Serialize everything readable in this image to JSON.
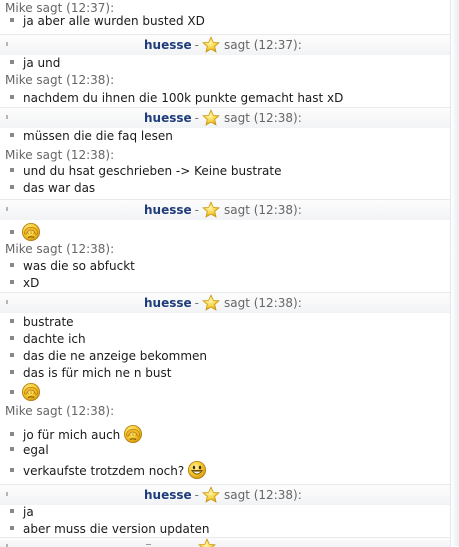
{
  "chat": {
    "blocks": [
      {
        "sender": "Mike",
        "time": "12:37",
        "header": "Mike sagt (12:37):",
        "type": "mike",
        "messages": [
          {
            "text": "ja aber alle wurden busted XD"
          }
        ]
      },
      {
        "sender": "huesse",
        "time": "12:37",
        "type": "self",
        "nick": "huesse",
        "separator": "-",
        "sagt": "sagt (12:37):",
        "icon": "star-icon",
        "messages": [
          {
            "text": "ja und"
          }
        ]
      },
      {
        "sender": "Mike",
        "time": "12:38",
        "header": "Mike sagt (12:38):",
        "type": "mike",
        "messages": [
          {
            "text": "nachdem du ihnen die 100k punkte gemacht hast xD"
          }
        ]
      },
      {
        "sender": "huesse",
        "time": "12:38",
        "type": "self",
        "nick": "huesse",
        "separator": "-",
        "sagt": "sagt (12:38):",
        "icon": "star-icon",
        "messages": [
          {
            "text": "müssen die die faq lesen"
          }
        ]
      },
      {
        "sender": "Mike",
        "time": "12:38",
        "header": "Mike sagt (12:38):",
        "type": "mike",
        "messages": [
          {
            "text": "und du hsat geschrieben -> Keine bustrate"
          },
          {
            "text": "das war das"
          }
        ]
      },
      {
        "sender": "huesse",
        "time": "12:38",
        "type": "self",
        "nick": "huesse",
        "separator": "-",
        "sagt": "sagt (12:38):",
        "icon": "star-icon",
        "messages": [
          {
            "text": "",
            "emoticon": "facepalm-emoticon-icon"
          }
        ]
      },
      {
        "sender": "Mike",
        "time": "12:38",
        "header": "Mike sagt (12:38):",
        "type": "mike",
        "messages": [
          {
            "text": "was die so abfuckt"
          },
          {
            "text": "xD"
          }
        ]
      },
      {
        "sender": "huesse",
        "time": "12:38",
        "type": "self",
        "nick": "huesse",
        "separator": "-",
        "sagt": "sagt (12:38):",
        "icon": "star-icon",
        "messages": [
          {
            "text": "bustrate"
          },
          {
            "text": "dachte ich"
          },
          {
            "text": "das die ne anzeige bekommen"
          },
          {
            "text": "das is für mich ne n bust"
          },
          {
            "text": "",
            "emoticon": "facepalm-emoticon-icon"
          }
        ]
      },
      {
        "sender": "Mike",
        "time": "12:38",
        "header": "Mike sagt (12:38):",
        "type": "mike",
        "messages": [
          {
            "text": "jo für mich auch",
            "emoticon": "facepalm-emoticon-icon"
          },
          {
            "text": "egal"
          },
          {
            "text": "verkaufste trotzdem noch?",
            "emoticon": "grin-emoticon-icon"
          }
        ]
      },
      {
        "sender": "huesse",
        "time": "12:38",
        "type": "self",
        "nick": "huesse",
        "separator": "-",
        "sagt": "sagt (12:38):",
        "icon": "star-icon",
        "messages": [
          {
            "text": "ja"
          },
          {
            "text": "aber muss die version updaten"
          }
        ]
      }
    ],
    "partial_header_icon": "star-icon"
  },
  "colors": {
    "mike_header": "#666666",
    "self_nick": "#1f3d7a",
    "message_text": "#1a1a1a",
    "bullet": "#888888",
    "star_fill": "#f7d13c",
    "emoticon_fill": "#f6cc2f"
  }
}
